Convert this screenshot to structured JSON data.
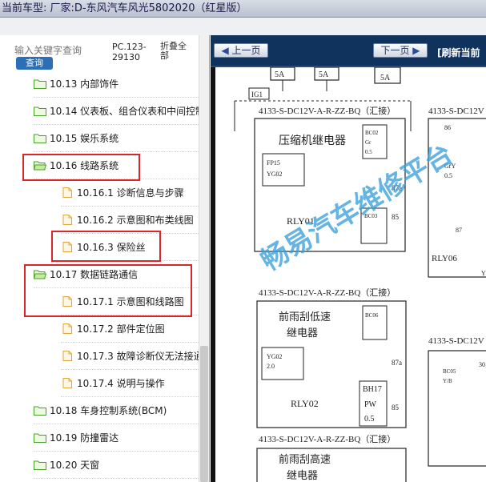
{
  "window": {
    "title": "当前车型:  厂家:D-东风汽车风光5802020（红星版）"
  },
  "search": {
    "placeholder": "输入关键字查询",
    "button_label": "查询",
    "pc_code": "PC.123-29130",
    "fold_all_label": "折叠全部"
  },
  "tree": {
    "items": [
      {
        "label": "10.13 内部饰件",
        "type": "folder"
      },
      {
        "label": "10.14 仪表板、组合仪表和中间控制台",
        "type": "folder"
      },
      {
        "label": "10.15 娱乐系统",
        "type": "folder"
      },
      {
        "label": "10.16 线路系统",
        "type": "folder-open"
      },
      {
        "label": "10.16.1 诊断信息与步骤",
        "type": "page"
      },
      {
        "label": "10.16.2 示意图和布类线图",
        "type": "page"
      },
      {
        "label": "10.16.3 保险丝",
        "type": "page"
      },
      {
        "label": "10.17 数据链路通信",
        "type": "folder-open"
      },
      {
        "label": "10.17.1 示意图和线路图",
        "type": "page"
      },
      {
        "label": "10.17.2 部件定位图",
        "type": "page"
      },
      {
        "label": "10.17.3 故障诊断仪无法接通",
        "type": "page"
      },
      {
        "label": "10.17.4 说明与操作",
        "type": "page"
      },
      {
        "label": "10.18 车身控制系统(BCM)",
        "type": "folder"
      },
      {
        "label": "10.19 防撞雷达",
        "type": "folder"
      },
      {
        "label": "10.20 天窗",
        "type": "folder"
      }
    ]
  },
  "toolbar": {
    "prev_label": "上一页",
    "next_label": "下一页",
    "refresh_label": "[刷新当前"
  },
  "diagram": {
    "watermark": "畅易汽车维修平台",
    "fuse_labels": [
      "5A",
      "5A",
      "5A"
    ],
    "ig": "IG1",
    "connectors": [
      "4133-S-DC12V-A-R-ZZ-BQ（汇接）",
      "4133-S-DC12V-A-R-ZZ-BQ（汇接）",
      "4133-S-DC12V-A-R-ZZ-BQ（汇接）",
      "4133-S-DC12V",
      "4133-S-DC12V"
    ],
    "relay1": "压缩机继电器",
    "relay2_a": "前雨刮低速",
    "relay2_b": "继电器",
    "relay3_a": "前雨刮高速",
    "relay3_b": "继电器",
    "rly_ids": [
      "RLY01",
      "RLY02",
      "RLY06"
    ],
    "pin_labels": [
      "BC02",
      "BC03",
      "BC05",
      "BC06",
      "BH17",
      "87a",
      "87",
      "85",
      "86",
      "30",
      "86"
    ],
    "wire_labels": [
      "FP15",
      "YG02",
      "Gr",
      "0.5",
      "2.0",
      "PW",
      "Y/B",
      "GrY",
      "YR"
    ]
  },
  "colors": {
    "accent": "#10335e",
    "highlight": "#d9262b",
    "button": "#2a6fb7",
    "watermark": "#3a9fd8"
  }
}
